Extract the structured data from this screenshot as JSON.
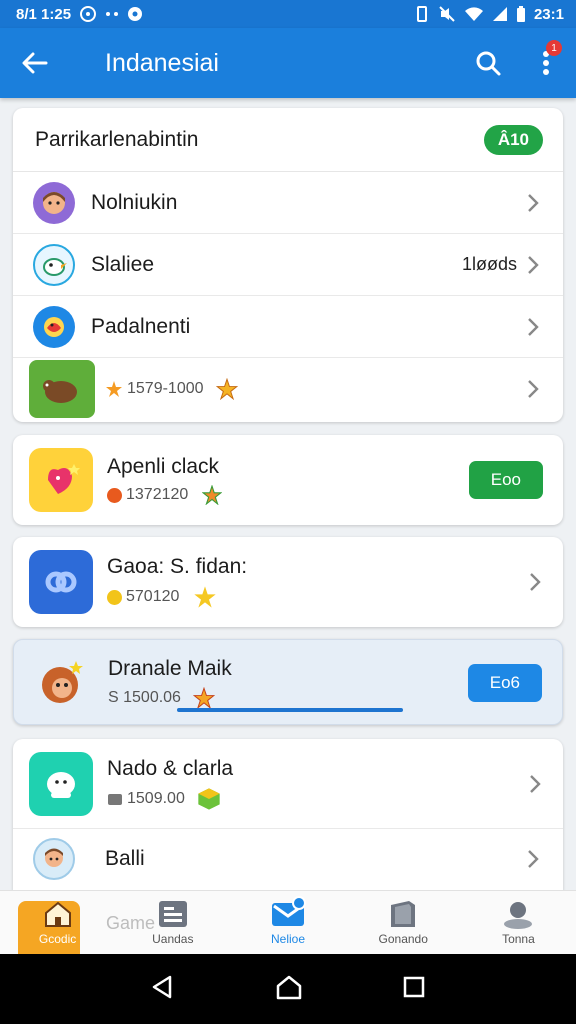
{
  "status_bar": {
    "time": "8/1 1:25",
    "right_text": "23:1"
  },
  "app_bar": {
    "title": "Indanesiai",
    "badge": "1"
  },
  "summary_card": {
    "title": "Parrikarlenabintin",
    "count": "Â10",
    "rows": [
      {
        "label": "Nolniukin",
        "value": ""
      },
      {
        "label": "Slaliee",
        "value": "1løøds"
      },
      {
        "label": "Padalnenti",
        "value": ""
      }
    ],
    "extra_row": {
      "meta": "1579-1000"
    }
  },
  "games": [
    {
      "title": "Apenli clack",
      "meta": "1372120",
      "action": "Eoo",
      "icon_color": "#ffd23a"
    },
    {
      "title": "Gaoa: S. fidan:",
      "meta": "570120",
      "action": "",
      "icon_color": "#2d6bd8"
    },
    {
      "title": "Dranale Maik",
      "meta": "S 1500.06",
      "action": "Eo6",
      "icon_color": "#e9a13b"
    },
    {
      "title": "Nado & clarla",
      "meta": "1509.00",
      "action": "",
      "icon_color": "#1fd1b0"
    },
    {
      "title": "Balli",
      "meta": "",
      "action": ""
    }
  ],
  "bottom_nav": {
    "ghost_label": "Game",
    "items": [
      {
        "label": "Gcodic"
      },
      {
        "label": "Uandas"
      },
      {
        "label": "Nelioe"
      },
      {
        "label": "Gonando"
      },
      {
        "label": "Tonna"
      }
    ]
  },
  "colors": {
    "app_bar": "#1b7fdc",
    "accent_green": "#21a245",
    "accent_blue": "#1e88e5"
  }
}
